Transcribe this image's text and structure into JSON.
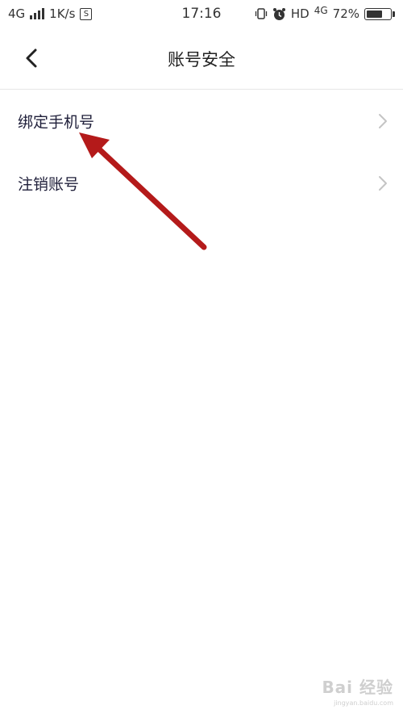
{
  "status_bar": {
    "network_left": "4G",
    "speed": "1K/s",
    "s_icon": "S",
    "time": "17:16",
    "hd": "HD",
    "network_right": "4G",
    "battery": "72%",
    "battery_level": 0.72
  },
  "header": {
    "title": "账号安全",
    "back_icon": "chevron-left-icon"
  },
  "list": {
    "items": [
      {
        "label": "绑定手机号",
        "icon": "chevron-right-icon"
      },
      {
        "label": "注销账号",
        "icon": "chevron-right-icon"
      }
    ]
  },
  "annotation": {
    "color": "#b41a1a",
    "type": "arrow"
  },
  "watermark": {
    "brand": "Bai 经验",
    "url": "jingyan.baidu.com"
  }
}
